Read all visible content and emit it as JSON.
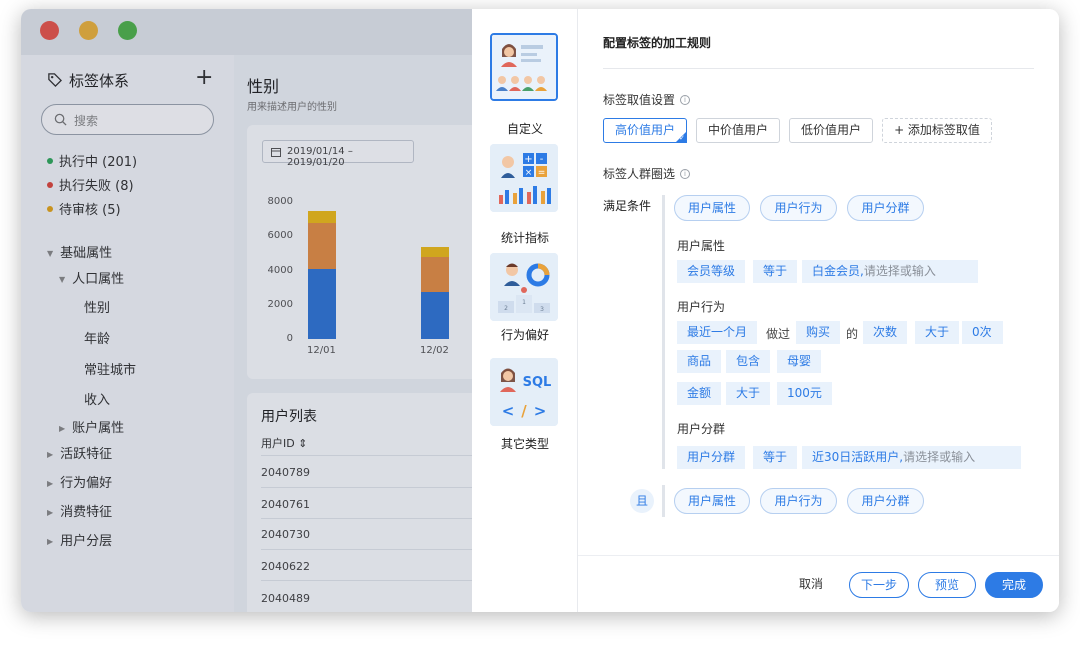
{
  "sidebar": {
    "title": "标签体系",
    "search_placeholder": "搜索",
    "statuses": [
      {
        "label": "执行中 (201)",
        "color": "#2fa55a"
      },
      {
        "label": "执行失败 (8)",
        "color": "#d9463d"
      },
      {
        "label": "待审核 (5)",
        "color": "#e0a21a"
      }
    ],
    "tree": {
      "basic": "基础属性",
      "population": "人口属性",
      "gender": "性别",
      "age": "年龄",
      "city": "常驻城市",
      "income": "收入",
      "account": "账户属性",
      "active": "活跃特征",
      "behavior": "行为偏好",
      "consume": "消费特征",
      "layer": "用户分层"
    }
  },
  "main": {
    "title": "性别",
    "subtitle": "用来描述用户的性别",
    "date_range": "2019/01/14 – 2019/01/20",
    "list_title": "用户列表",
    "col_user_id": "用户ID ⇕",
    "rows": [
      "2040789",
      "2040761",
      "2040730",
      "2040622",
      "2040489"
    ]
  },
  "chart_data": {
    "type": "bar",
    "stacked": true,
    "categories": [
      "12/01",
      "12/02"
    ],
    "series": [
      {
        "values": [
          4100,
          2750
        ],
        "color": "#2f73d2"
      },
      {
        "values": [
          2700,
          2050
        ],
        "color": "#e08b44"
      },
      {
        "values": [
          650,
          600
        ],
        "color": "#e9b818"
      }
    ],
    "yticks": [
      "8000",
      "6000",
      "4000",
      "2000",
      "0"
    ],
    "ylim": [
      0,
      8000
    ]
  },
  "types": [
    {
      "label": "自定义"
    },
    {
      "label": "统计指标"
    },
    {
      "label": "行为偏好"
    },
    {
      "label": "其它类型"
    }
  ],
  "config": {
    "title": "配置标签的加工规则",
    "value_setting": "标签取值设置",
    "values": [
      "高价值用户",
      "中价值用户",
      "低价值用户"
    ],
    "add_value": "+ 添加标签取值",
    "crowd": "标签人群圈选",
    "satisfy": "满足条件",
    "pills": [
      "用户属性",
      "用户行为",
      "用户分群"
    ],
    "g1_label": "用户属性",
    "g1": {
      "field": "会员等级",
      "op": "等于",
      "val": "白金会员,",
      "ph": "请选择或输入"
    },
    "g2_label": "用户行为",
    "g2": {
      "time": "最近一个月",
      "did": "做过",
      "act": "购买",
      "of": "的",
      "metric": "次数",
      "op": "大于",
      "val": "0次",
      "f2": "商品",
      "op2": "包含",
      "v2": "母婴",
      "f3": "金额",
      "op3": "大于",
      "v3": "100元"
    },
    "g3_label": "用户分群",
    "g3": {
      "field": "用户分群",
      "op": "等于",
      "val": "近30日活跃用户,",
      "ph": "请选择或输入"
    },
    "and": "且"
  },
  "footer": {
    "cancel": "取消",
    "next": "下一步",
    "preview": "预览",
    "done": "完成"
  }
}
